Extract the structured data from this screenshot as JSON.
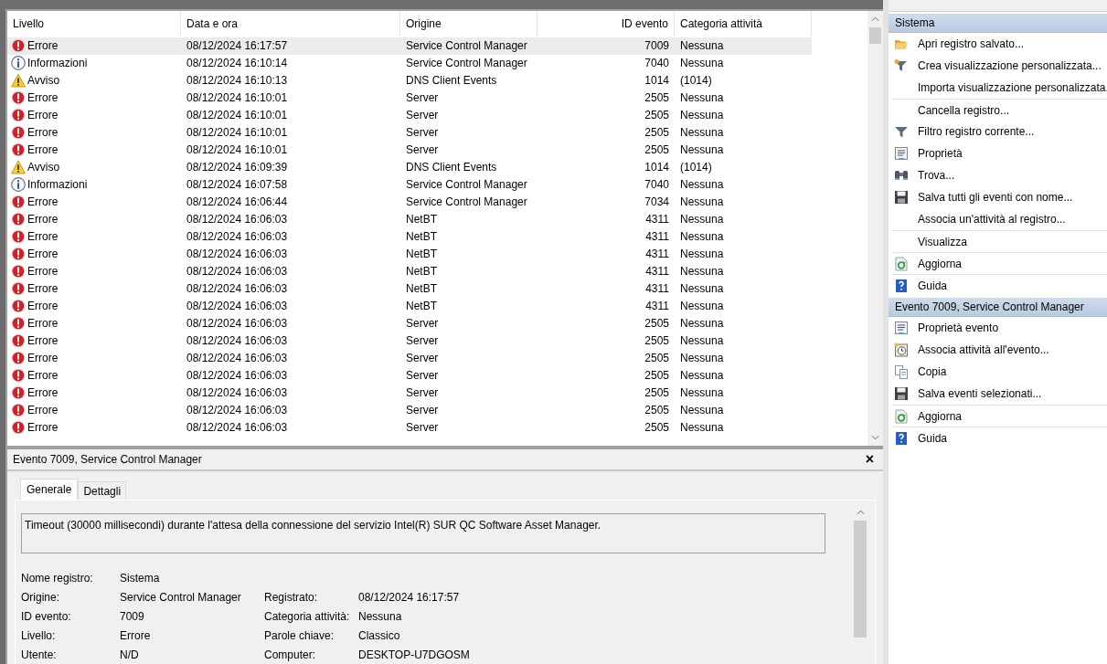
{
  "table": {
    "columns": [
      {
        "label": "Livello"
      },
      {
        "label": "Data e ora"
      },
      {
        "label": "Origine"
      },
      {
        "label": "ID evento"
      },
      {
        "label": "Categoria attività"
      }
    ],
    "rows": [
      {
        "kind": "error",
        "level": "Errore",
        "date": "08/12/2024 16:17:57",
        "source": "Service Control Manager",
        "id": "7009",
        "category": "Nessuna",
        "selected": true
      },
      {
        "kind": "info",
        "level": "Informazioni",
        "date": "08/12/2024 16:10:14",
        "source": "Service Control Manager",
        "id": "7040",
        "category": "Nessuna",
        "selected": false
      },
      {
        "kind": "warning",
        "level": "Avviso",
        "date": "08/12/2024 16:10:13",
        "source": "DNS Client Events",
        "id": "1014",
        "category": "(1014)",
        "selected": false
      },
      {
        "kind": "error",
        "level": "Errore",
        "date": "08/12/2024 16:10:01",
        "source": "Server",
        "id": "2505",
        "category": "Nessuna",
        "selected": false
      },
      {
        "kind": "error",
        "level": "Errore",
        "date": "08/12/2024 16:10:01",
        "source": "Server",
        "id": "2505",
        "category": "Nessuna",
        "selected": false
      },
      {
        "kind": "error",
        "level": "Errore",
        "date": "08/12/2024 16:10:01",
        "source": "Server",
        "id": "2505",
        "category": "Nessuna",
        "selected": false
      },
      {
        "kind": "error",
        "level": "Errore",
        "date": "08/12/2024 16:10:01",
        "source": "Server",
        "id": "2505",
        "category": "Nessuna",
        "selected": false
      },
      {
        "kind": "warning",
        "level": "Avviso",
        "date": "08/12/2024 16:09:39",
        "source": "DNS Client Events",
        "id": "1014",
        "category": "(1014)",
        "selected": false
      },
      {
        "kind": "info",
        "level": "Informazioni",
        "date": "08/12/2024 16:07:58",
        "source": "Service Control Manager",
        "id": "7040",
        "category": "Nessuna",
        "selected": false
      },
      {
        "kind": "error",
        "level": "Errore",
        "date": "08/12/2024 16:06:44",
        "source": "Service Control Manager",
        "id": "7034",
        "category": "Nessuna",
        "selected": false
      },
      {
        "kind": "error",
        "level": "Errore",
        "date": "08/12/2024 16:06:03",
        "source": "NetBT",
        "id": "4311",
        "category": "Nessuna",
        "selected": false
      },
      {
        "kind": "error",
        "level": "Errore",
        "date": "08/12/2024 16:06:03",
        "source": "NetBT",
        "id": "4311",
        "category": "Nessuna",
        "selected": false
      },
      {
        "kind": "error",
        "level": "Errore",
        "date": "08/12/2024 16:06:03",
        "source": "NetBT",
        "id": "4311",
        "category": "Nessuna",
        "selected": false
      },
      {
        "kind": "error",
        "level": "Errore",
        "date": "08/12/2024 16:06:03",
        "source": "NetBT",
        "id": "4311",
        "category": "Nessuna",
        "selected": false
      },
      {
        "kind": "error",
        "level": "Errore",
        "date": "08/12/2024 16:06:03",
        "source": "NetBT",
        "id": "4311",
        "category": "Nessuna",
        "selected": false
      },
      {
        "kind": "error",
        "level": "Errore",
        "date": "08/12/2024 16:06:03",
        "source": "NetBT",
        "id": "4311",
        "category": "Nessuna",
        "selected": false
      },
      {
        "kind": "error",
        "level": "Errore",
        "date": "08/12/2024 16:06:03",
        "source": "Server",
        "id": "2505",
        "category": "Nessuna",
        "selected": false
      },
      {
        "kind": "error",
        "level": "Errore",
        "date": "08/12/2024 16:06:03",
        "source": "Server",
        "id": "2505",
        "category": "Nessuna",
        "selected": false
      },
      {
        "kind": "error",
        "level": "Errore",
        "date": "08/12/2024 16:06:03",
        "source": "Server",
        "id": "2505",
        "category": "Nessuna",
        "selected": false
      },
      {
        "kind": "error",
        "level": "Errore",
        "date": "08/12/2024 16:06:03",
        "source": "Server",
        "id": "2505",
        "category": "Nessuna",
        "selected": false
      },
      {
        "kind": "error",
        "level": "Errore",
        "date": "08/12/2024 16:06:03",
        "source": "Server",
        "id": "2505",
        "category": "Nessuna",
        "selected": false
      },
      {
        "kind": "error",
        "level": "Errore",
        "date": "08/12/2024 16:06:03",
        "source": "Server",
        "id": "2505",
        "category": "Nessuna",
        "selected": false
      },
      {
        "kind": "error",
        "level": "Errore",
        "date": "08/12/2024 16:06:03",
        "source": "Server",
        "id": "2505",
        "category": "Nessuna",
        "selected": false
      }
    ]
  },
  "details": {
    "title": "Evento 7009, Service Control Manager",
    "close": "×",
    "tabs": [
      {
        "label": "Generale",
        "selected": true
      },
      {
        "label": "Dettagli",
        "selected": false
      }
    ],
    "message": "Timeout (30000 millisecondi) durante l'attesa della connessione del servizio Intel(R) SUR QC Software Asset Manager.",
    "rows": [
      {
        "cells": [
          {
            "label": "Nome registro:",
            "value": "Sistema"
          }
        ]
      },
      {
        "cells": [
          {
            "label": "Origine:",
            "value": "Service Control Manager"
          },
          {
            "label": "Registrato:",
            "value": "08/12/2024 16:17:57"
          }
        ]
      },
      {
        "cells": [
          {
            "label": "ID evento:",
            "value": "7009"
          },
          {
            "label": "Categoria attività:",
            "value": "Nessuna"
          }
        ]
      },
      {
        "cells": [
          {
            "label": "Livello:",
            "value": "Errore"
          },
          {
            "label": "Parole chiave:",
            "value": "Classico"
          }
        ]
      },
      {
        "cells": [
          {
            "label": "Utente:",
            "value": "N/D"
          },
          {
            "label": "Computer:",
            "value": "DESKTOP-U7DGOSM"
          }
        ]
      }
    ]
  },
  "actions": [
    {
      "title": "Sistema",
      "items": [
        {
          "kind": "folder",
          "label": "Apri registro salvato...",
          "divider_above": false
        },
        {
          "kind": "filter-star",
          "label": "Crea visualizzazione personalizzata...",
          "divider_above": false
        },
        {
          "kind": "none",
          "label": "Importa visualizzazione personalizzata.",
          "divider_above": false
        },
        {
          "kind": "none",
          "label": "Cancella registro...",
          "divider_above": true
        },
        {
          "kind": "filter",
          "label": "Filtro registro corrente...",
          "divider_above": false
        },
        {
          "kind": "properties",
          "label": "Proprietà",
          "divider_above": false
        },
        {
          "kind": "binoculars",
          "label": "Trova...",
          "divider_above": false
        },
        {
          "kind": "save",
          "label": "Salva tutti gli eventi con nome...",
          "divider_above": false
        },
        {
          "kind": "none",
          "label": "Associa un'attività al registro...",
          "divider_above": false
        },
        {
          "kind": "none",
          "label": "Visualizza",
          "divider_above": true
        },
        {
          "kind": "refresh",
          "label": "Aggiorna",
          "divider_above": true
        },
        {
          "kind": "help",
          "label": "Guida",
          "divider_above": true
        }
      ]
    },
    {
      "title": "Evento 7009, Service Control Manager",
      "items": [
        {
          "kind": "properties",
          "label": "Proprietà evento",
          "divider_above": false
        },
        {
          "kind": "clock",
          "label": "Associa attività all'evento...",
          "divider_above": false
        },
        {
          "kind": "copy",
          "label": "Copia",
          "divider_above": false
        },
        {
          "kind": "save",
          "label": "Salva eventi selezionati...",
          "divider_above": false
        },
        {
          "kind": "refresh",
          "label": "Aggiorna",
          "divider_above": true
        },
        {
          "kind": "help",
          "label": "Guida",
          "divider_above": true
        }
      ]
    }
  ]
}
